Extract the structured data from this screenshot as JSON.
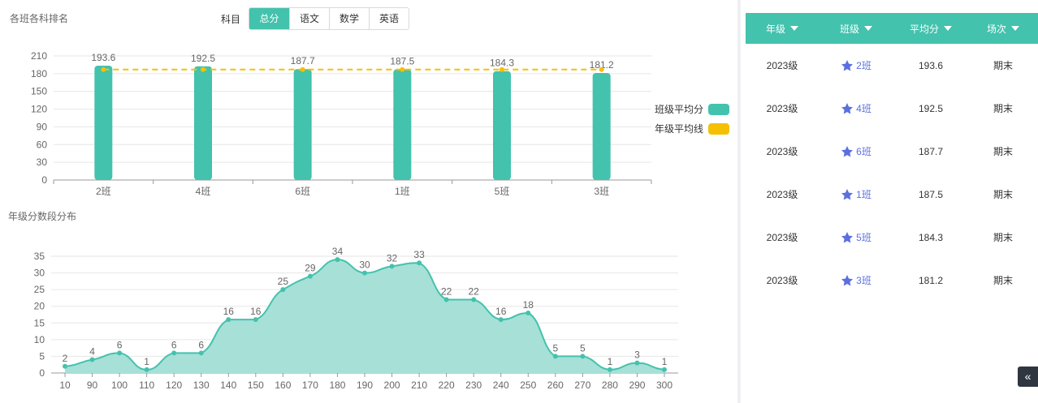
{
  "bar_chart": {
    "title": "各班各科排名",
    "subject_label": "科目",
    "subjects": [
      "总分",
      "语文",
      "数学",
      "英语"
    ],
    "active_subject": "总分",
    "legend": {
      "bar": "班级平均分",
      "line": "年级平均线"
    },
    "colors": {
      "bar": "#43c2ad",
      "line": "#f5c000"
    }
  },
  "dist_chart": {
    "title": "年级分数段分布",
    "colors": {
      "line": "#43c2ad",
      "area": "#a7e0d7"
    }
  },
  "chart_data": [
    {
      "type": "bar",
      "title": "各班各科排名",
      "categories": [
        "2班",
        "4班",
        "6班",
        "1班",
        "5班",
        "3班"
      ],
      "series": [
        {
          "name": "班级平均分",
          "values": [
            193.6,
            192.5,
            187.7,
            187.5,
            184.3,
            181.2
          ]
        }
      ],
      "reference_line": {
        "name": "年级平均线",
        "value": 187
      },
      "ylim": [
        0,
        210
      ],
      "yticks": [
        0,
        30,
        60,
        90,
        120,
        150,
        180,
        210
      ],
      "legend_position": "right",
      "grid": true
    },
    {
      "type": "area",
      "title": "年级分数段分布",
      "x": [
        10,
        90,
        100,
        110,
        120,
        130,
        140,
        150,
        160,
        170,
        180,
        190,
        200,
        210,
        220,
        230,
        240,
        250,
        260,
        270,
        280,
        290,
        300
      ],
      "values": [
        2,
        4,
        6,
        1,
        6,
        6,
        16,
        16,
        25,
        29,
        34,
        30,
        32,
        33,
        22,
        22,
        16,
        18,
        5,
        5,
        1,
        3,
        1
      ],
      "ylim": [
        0,
        35
      ],
      "yticks": [
        0,
        5,
        10,
        15,
        20,
        25,
        30,
        35
      ],
      "grid": true
    }
  ],
  "table": {
    "headers": [
      "年级",
      "班级",
      "平均分",
      "场次"
    ],
    "rows": [
      {
        "grade": "2023级",
        "class": "2班",
        "avg": "193.6",
        "session": "期末"
      },
      {
        "grade": "2023级",
        "class": "4班",
        "avg": "192.5",
        "session": "期末"
      },
      {
        "grade": "2023级",
        "class": "6班",
        "avg": "187.7",
        "session": "期末"
      },
      {
        "grade": "2023级",
        "class": "1班",
        "avg": "187.5",
        "session": "期末"
      },
      {
        "grade": "2023级",
        "class": "5班",
        "avg": "184.3",
        "session": "期末"
      },
      {
        "grade": "2023级",
        "class": "3班",
        "avg": "181.2",
        "session": "期末"
      }
    ],
    "class_icon": "star-icon",
    "colors": {
      "header": "#43c2ad",
      "link": "#5b6fe0"
    }
  },
  "collapse_button": {
    "label": "«",
    "icon": "double-chevron-left-icon"
  }
}
